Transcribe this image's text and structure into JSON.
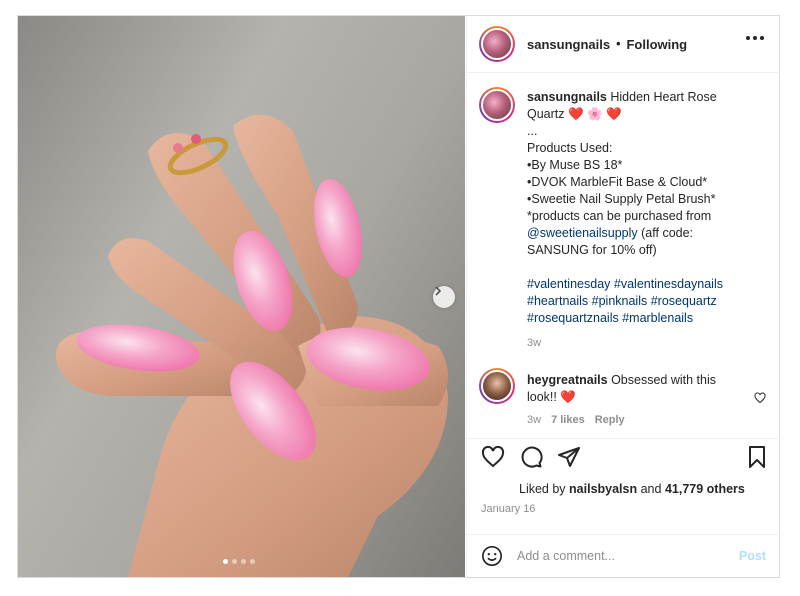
{
  "post": {
    "username": "sansungnails",
    "follow_status": "Following",
    "separator": "•",
    "caption": {
      "username": "sansungnails",
      "title": "Hidden Heart Rose Quartz",
      "title_emojis": "❤️ 🌸 ❤️",
      "lines": [
        "...",
        "Products Used:",
        "•By Muse BS 18*",
        "•DVOK MarbleFit Base & Cloud*",
        "•Sweetie Nail Supply Petal Brush*",
        "*products can be purchased from"
      ],
      "mention": "@sweetienailsupply",
      "mention_tail": " (aff code:",
      "code_line": "SANSUNG for 10% off)",
      "hashtags": [
        "#valentinesday",
        "#valentinesdaynails",
        "#heartnails",
        "#pinknails",
        "#rosequartz",
        "#rosequartznails",
        "#marblenails"
      ],
      "age": "3w"
    },
    "comment": {
      "username": "heygreatnails",
      "text": "Obsessed with this look!!",
      "emoji": "❤️",
      "age": "3w",
      "likes": "7 likes",
      "reply": "Reply"
    },
    "liked_by_prefix": "Liked by ",
    "liked_by_user": "nailsbyalsn",
    "liked_by_mid": " and ",
    "liked_by_count": "41,779 others",
    "date": "January 16",
    "add_comment_placeholder": "Add a comment...",
    "post_button": "Post"
  },
  "icons": {
    "more": "more-horizontal-icon",
    "like": "heart-outline-icon",
    "comment": "comment-bubble-icon",
    "share": "paper-plane-icon",
    "save": "bookmark-icon",
    "emoji": "smiley-icon",
    "next": "chevron-right-icon"
  },
  "carousel": {
    "slides": 4,
    "active": 1
  },
  "colors": {
    "link": "#00376b",
    "muted": "#8e8e8e",
    "post_disabled": "#b2dffc",
    "heart": "#e02048"
  }
}
